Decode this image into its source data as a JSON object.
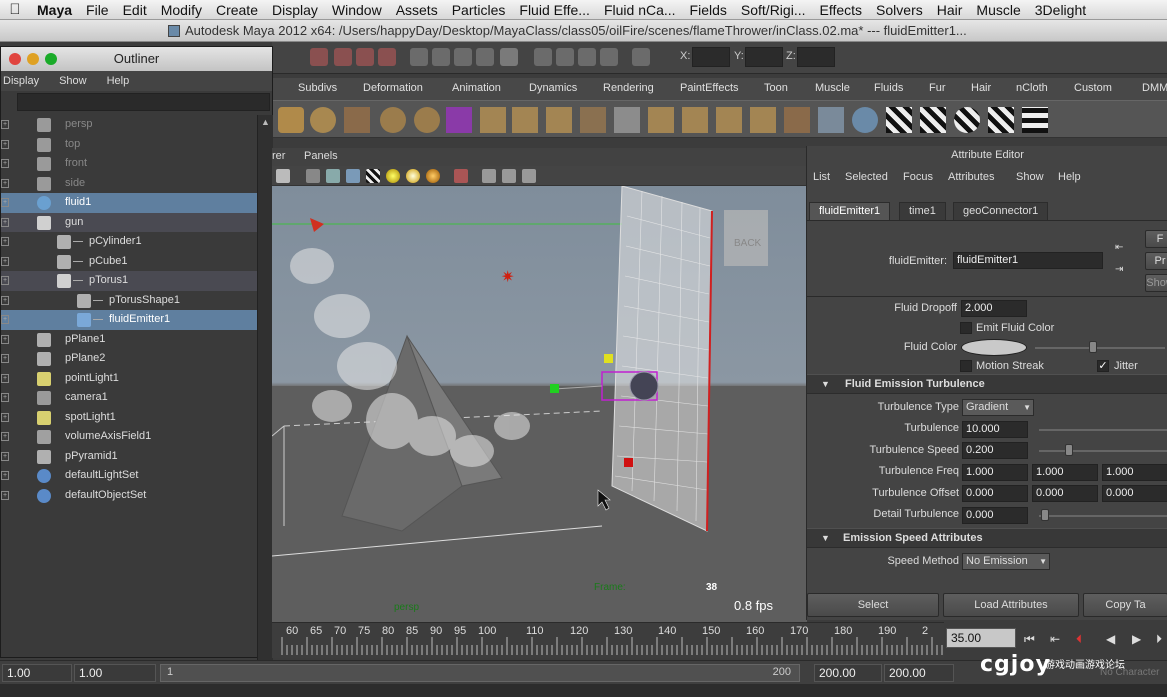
{
  "mac_menu": {
    "items": [
      "Maya",
      "File",
      "Edit",
      "Modify",
      "Create",
      "Display",
      "Window",
      "Assets",
      "Particles",
      "Fluid Effe...",
      "Fluid nCa...",
      "Fields",
      "Soft/Rigi...",
      "Effects",
      "Solvers",
      "Hair",
      "Muscle",
      "3Delight"
    ]
  },
  "window_title": "Autodesk Maya 2012 x64: /Users/happyDay/Desktop/MayaClass/class05/oilFire/scenes/flameThrower/inClass.02.ma*  ---  fluidEmitter1...",
  "status_line": {
    "x_label": "X:",
    "y_label": "Y:",
    "z_label": "Z:"
  },
  "shelf_tabs": [
    "Subdivs",
    "Deformation",
    "Animation",
    "Dynamics",
    "Rendering",
    "PaintEffects",
    "Toon",
    "Muscle",
    "Fluids",
    "Fur",
    "Hair",
    "nCloth",
    "Custom",
    "DMM"
  ],
  "outliner": {
    "title": "Outliner",
    "menu": [
      "Display",
      "Show",
      "Help"
    ],
    "rows": [
      {
        "label": "persp",
        "icon": "camera-icon",
        "indent": 0,
        "state": "dim"
      },
      {
        "label": "top",
        "icon": "camera-icon",
        "indent": 0,
        "state": "dim"
      },
      {
        "label": "front",
        "icon": "camera-icon",
        "indent": 0,
        "state": "dim"
      },
      {
        "label": "side",
        "icon": "camera-icon",
        "indent": 0,
        "state": "dim"
      },
      {
        "label": "fluid1",
        "icon": "fluid-icon",
        "indent": 0,
        "state": "selected"
      },
      {
        "label": "gun",
        "icon": "transform-icon",
        "indent": 0,
        "state": "parent"
      },
      {
        "label": "pCylinder1",
        "icon": "mesh-icon",
        "indent": 1,
        "state": ""
      },
      {
        "label": "pCube1",
        "icon": "mesh-icon",
        "indent": 1,
        "state": ""
      },
      {
        "label": "pTorus1",
        "icon": "transform-icon",
        "indent": 1,
        "state": "parent"
      },
      {
        "label": "pTorusShape1",
        "icon": "mesh-icon",
        "indent": 2,
        "state": ""
      },
      {
        "label": "fluidEmitter1",
        "icon": "emitter-icon",
        "indent": 2,
        "state": "selected"
      },
      {
        "label": "pPlane1",
        "icon": "mesh-icon",
        "indent": 0,
        "state": ""
      },
      {
        "label": "pPlane2",
        "icon": "mesh-icon",
        "indent": 0,
        "state": ""
      },
      {
        "label": "pointLight1",
        "icon": "point-light-icon",
        "indent": 0,
        "state": ""
      },
      {
        "label": "camera1",
        "icon": "camera-icon",
        "indent": 0,
        "state": ""
      },
      {
        "label": "spotLight1",
        "icon": "spot-light-icon",
        "indent": 0,
        "state": ""
      },
      {
        "label": "volumeAxisField1",
        "icon": "field-icon",
        "indent": 0,
        "state": ""
      },
      {
        "label": "pPyramid1",
        "icon": "mesh-icon",
        "indent": 0,
        "state": ""
      },
      {
        "label": "defaultLightSet",
        "icon": "set-icon",
        "indent": 0,
        "state": ""
      },
      {
        "label": "defaultObjectSet",
        "icon": "set-icon",
        "indent": 0,
        "state": ""
      }
    ]
  },
  "viewport": {
    "menu": [
      "rer",
      "Panels"
    ],
    "camera_label": "persp",
    "frame_label": "Frame:",
    "frame_value": "38",
    "fps": "0.8 fps",
    "viewcube_label": "BACK"
  },
  "attribute_editor": {
    "title": "Attribute Editor",
    "menu": [
      "List",
      "Selected",
      "Focus",
      "Attributes",
      "Show",
      "Help"
    ],
    "tabs": [
      "fluidEmitter1",
      "time1",
      "geoConnector1"
    ],
    "node_label": "fluidEmitter:",
    "node_value": "fluidEmitter1",
    "fluid_dropoff_label": "Fluid Dropoff",
    "fluid_dropoff_value": "2.000",
    "emit_fluid_color_label": "Emit Fluid Color",
    "fluid_color_label": "Fluid Color",
    "motion_streak_label": "Motion Streak",
    "jitter_label": "Jitter",
    "jitter_check": "✓",
    "section_turbulence": "Fluid Emission Turbulence",
    "turbulence_type_label": "Turbulence Type",
    "turbulence_type_value": "Gradient",
    "turbulence_label": "Turbulence",
    "turbulence_value": "10.000",
    "turbulence_speed_label": "Turbulence Speed",
    "turbulence_speed_value": "0.200",
    "turbulence_freq_label": "Turbulence Freq",
    "turbulence_freq_values": [
      "1.000",
      "1.000",
      "1.000"
    ],
    "turbulence_offset_label": "Turbulence Offset",
    "turbulence_offset_values": [
      "0.000",
      "0.000",
      "0.000"
    ],
    "detail_turbulence_label": "Detail Turbulence",
    "detail_turbulence_value": "0.000",
    "section_speed": "Emission Speed Attributes",
    "speed_method_label": "Speed Method",
    "speed_method_value": "No Emission",
    "buttons": [
      "Select",
      "Load Attributes",
      "Copy Ta"
    ],
    "side_buttons": [
      "F",
      "Pr",
      "Show"
    ]
  },
  "time_slider": {
    "ticks": [
      "60",
      "65",
      "70",
      "75",
      "80",
      "85",
      "90",
      "95",
      "100",
      "110",
      "120",
      "130",
      "140",
      "150",
      "160",
      "170",
      "180",
      "190",
      "2"
    ],
    "current_frame": "35.00"
  },
  "range_slider": {
    "start_time": "1.00",
    "start_range": "1.00",
    "range_start_mark": "1",
    "range_end_mark": "200",
    "end_range": "200.00",
    "end_time": "200.00",
    "char_set": "No Character"
  },
  "watermark": {
    "logo": "cgjoy",
    "text": "游戏动画游戏论坛"
  },
  "colors": {
    "selection": "#5f7f9f",
    "viewport_sky": "#8b97a3",
    "viewport_ground": "#5a5a5a",
    "frame_color": "#d01010"
  }
}
